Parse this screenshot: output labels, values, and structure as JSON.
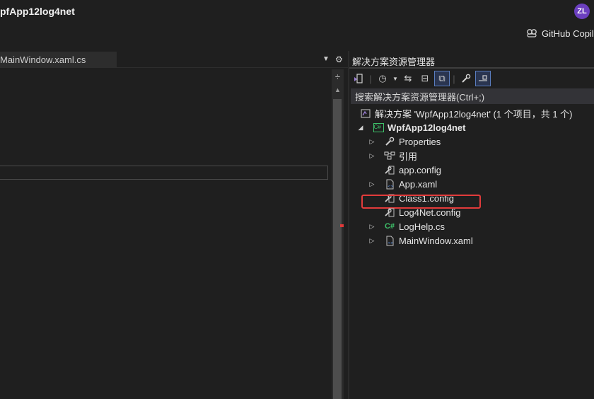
{
  "window": {
    "title": "pfApp12log4net",
    "avatar_initials": "ZL",
    "copilot_label": "GitHub Copil"
  },
  "editor": {
    "tab_label": "MainWindow.xaml.cs",
    "dropdown_icon": "chevron-down-icon",
    "settings_icon": "gear-icon"
  },
  "solution_explorer": {
    "title": "解决方案资源管理器",
    "search_placeholder": "搜索解决方案资源管理器(Ctrl+;)",
    "toolbar": [
      {
        "name": "switch-views-icon",
        "glyph": "⇲"
      },
      {
        "name": "history-icon",
        "glyph": "⏲"
      },
      {
        "name": "sync-icon",
        "glyph": "⇆"
      },
      {
        "name": "collapse-all-icon",
        "glyph": "⊟"
      },
      {
        "name": "show-all-files-icon",
        "glyph": "⧉"
      },
      {
        "name": "properties-wrench-icon",
        "glyph": "🔧"
      },
      {
        "name": "preview-icon",
        "glyph": "⊷"
      }
    ],
    "tree": {
      "solution_label": "解决方案 'WpfApp12log4net' (1 个项目，共 1 个)",
      "project_label": "WpfApp12log4net",
      "items": [
        {
          "label": "Properties",
          "icon": "wrench-icon",
          "expandable": true
        },
        {
          "label": "引用",
          "icon": "references-icon",
          "expandable": true
        },
        {
          "label": "app.config",
          "icon": "config-file-icon",
          "expandable": false
        },
        {
          "label": "App.xaml",
          "icon": "xaml-file-icon",
          "expandable": true
        },
        {
          "label": "Class1.config",
          "icon": "config-file-icon",
          "expandable": false,
          "highlighted": true
        },
        {
          "label": "Log4Net.config",
          "icon": "config-file-icon",
          "expandable": false
        },
        {
          "label": "LogHelp.cs",
          "icon": "csharp-file-icon",
          "expandable": true
        },
        {
          "label": "MainWindow.xaml",
          "icon": "xaml-file-icon",
          "expandable": true
        }
      ]
    }
  },
  "colors": {
    "background": "#1f1f1f",
    "highlight": "#e23b3b",
    "csharp": "#3ec26a",
    "accent": "#6b3fbf"
  }
}
